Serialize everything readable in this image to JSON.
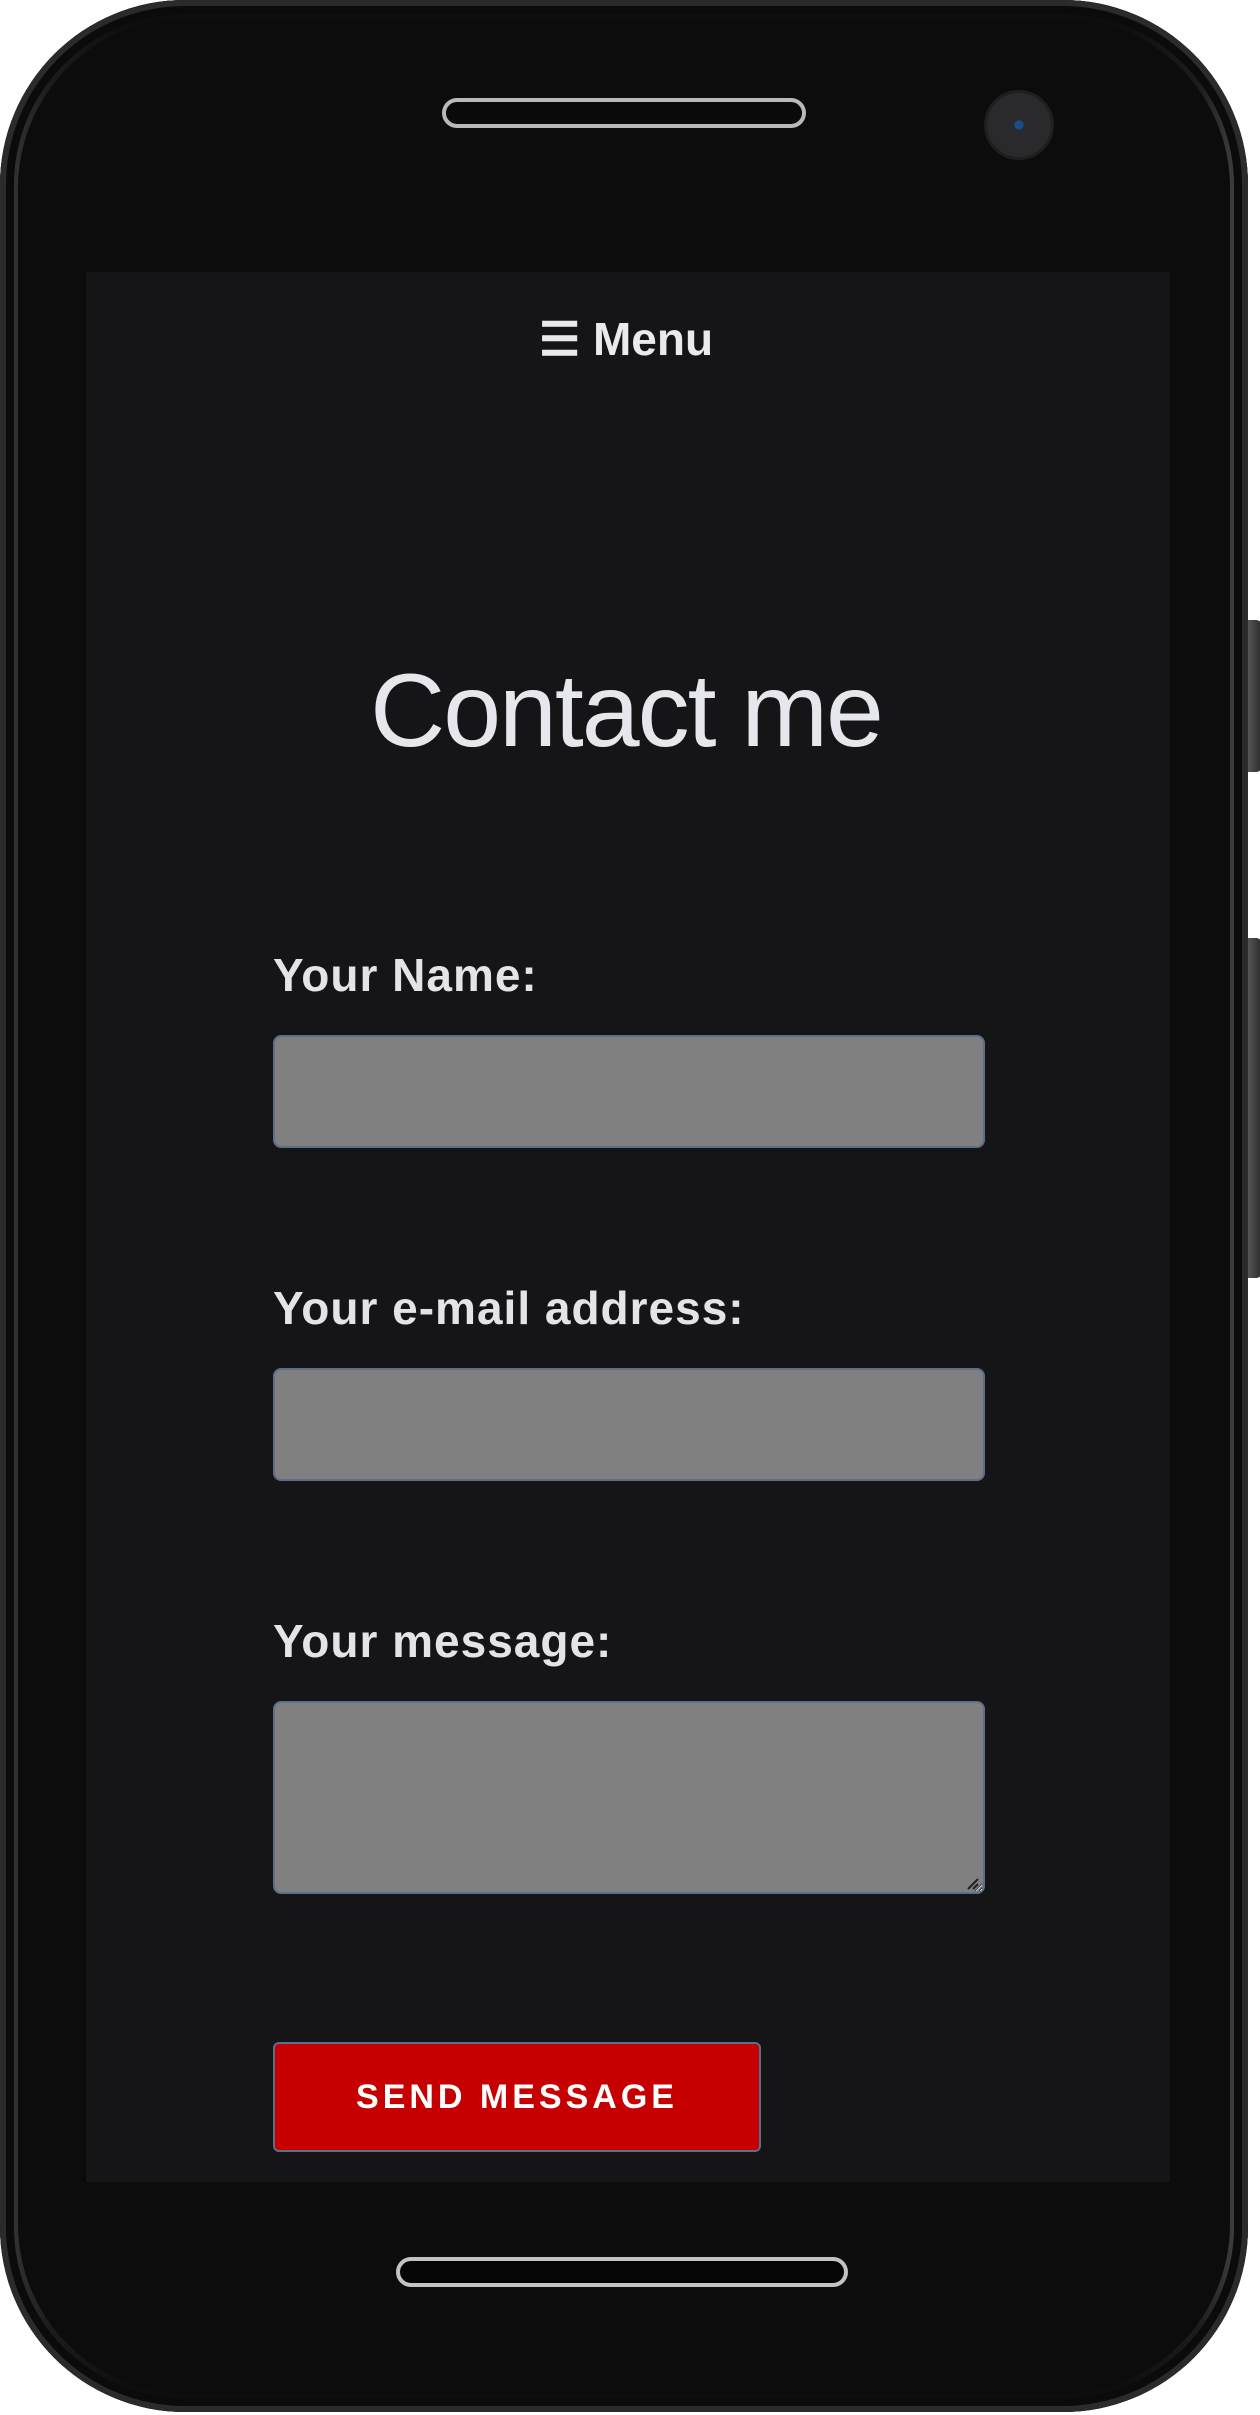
{
  "nav": {
    "menu_label": "☰ Menu",
    "menu_icon": "hamburger-menu-icon"
  },
  "page": {
    "title": "Contact me"
  },
  "form": {
    "name_label": "Your Name:",
    "name_value": "",
    "email_label": "Your e-mail address:",
    "email_value": "",
    "message_label": "Your message:",
    "message_value": "",
    "submit_label": "SEND MESSAGE"
  },
  "colors": {
    "background": "#151517",
    "input_background": "#808080",
    "input_border": "#5c6f88",
    "button_background": "#c60000",
    "text": "#e8e8ec"
  }
}
